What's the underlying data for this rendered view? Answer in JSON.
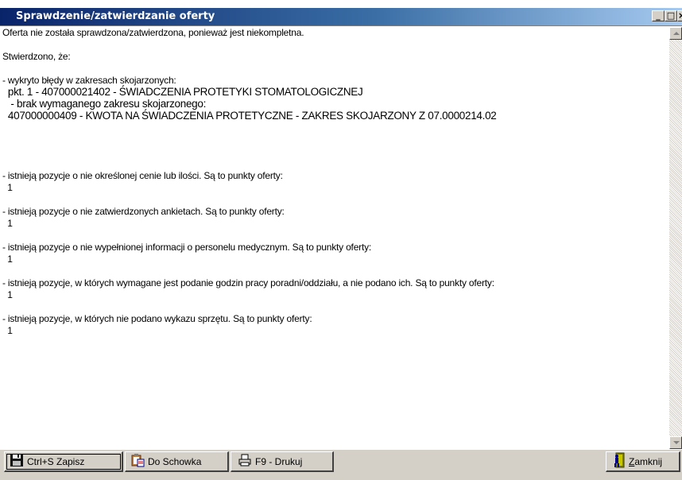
{
  "window": {
    "title": "Sprawdzenie/zatwierdzanie oferty",
    "controls": {
      "minimize": "_",
      "maximize": "□",
      "close": "×"
    }
  },
  "message": {
    "lines": [
      "Oferta nie została sprawdzona/zatwierdzona, ponieważ jest niekompletna.",
      "",
      "Stwierdzono, że:",
      "",
      "- wykryto błędy w zakresach skojarzonych:",
      "  pkt. 1 - 407000021402 - ŚWIADCZENIA PROTETYKI STOMATOLOGICZNEJ",
      "   - brak wymaganego zakresu skojarzonego:",
      "  407000000409 - KWOTA NA ŚWIADCZENIA PROTETYCZNE - ZAKRES SKOJARZONY Z 07.0000214.02",
      "",
      "",
      "",
      "",
      "- istnieją pozycje o nie określonej cenie lub ilości. Są to punkty oferty:",
      "  1",
      "",
      "- istnieją pozycje o nie zatwierdzonych ankietach. Są to punkty oferty:",
      "  1",
      "",
      "- istnieją pozycje o nie wypełnionej informacji o personelu medycznym. Są to punkty oferty:",
      "  1",
      "",
      "- istnieją pozycje, w których wymagane jest podanie godzin pracy poradni/oddziału, a nie podano ich. Są to punkty oferty:",
      "  1",
      "",
      "- istnieją pozycje, w których nie podano wykazu sprzętu. Są to punkty oferty:",
      "  1"
    ]
  },
  "buttons": {
    "save": {
      "label": "Ctrl+S Zapisz",
      "icon": "floppy-disk-icon"
    },
    "clipboard": {
      "label": "Do Schowka",
      "icon": "clipboard-icon"
    },
    "print": {
      "label": "F9 - Drukuj",
      "icon": "printer-icon"
    },
    "close": {
      "label_prefix": "",
      "label_underlined": "Z",
      "label_rest": "amknij",
      "icon": "door-exit-icon"
    }
  },
  "colors": {
    "titlebar_start": "#0a246a",
    "titlebar_end": "#a6caf0",
    "face": "#d4d0c8"
  }
}
